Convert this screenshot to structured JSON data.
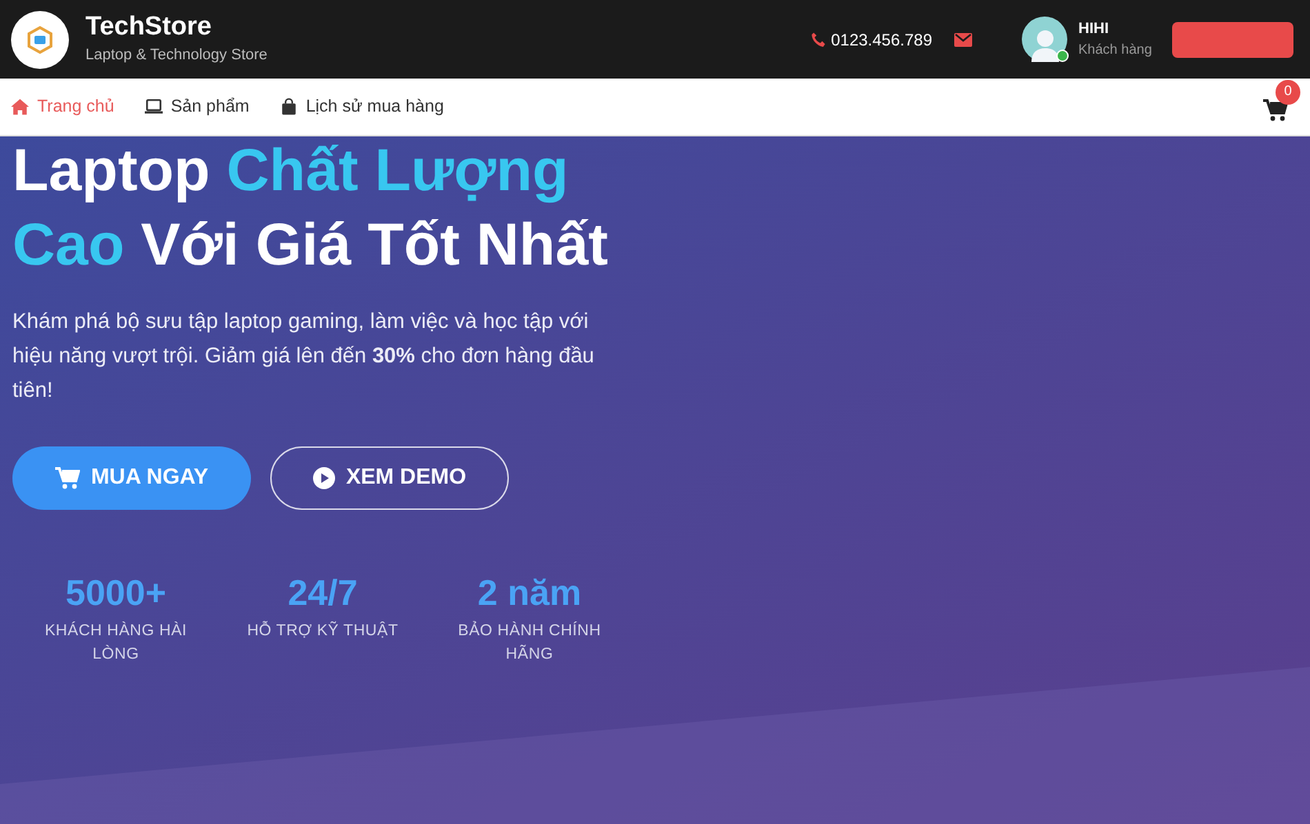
{
  "header": {
    "brand": "TechStore",
    "tagline": "Laptop & Technology Store",
    "phone": "0123.456.789",
    "user": {
      "name": "HIHI",
      "role": "Khách hàng",
      "online": true
    }
  },
  "nav": {
    "items": [
      {
        "label": "Trang chủ",
        "selected": true
      },
      {
        "label": "Sản phẩm",
        "selected": false
      },
      {
        "label": "Lịch sử mua hàng",
        "selected": false
      }
    ],
    "cart_count": "0"
  },
  "hero": {
    "title": [
      {
        "text": "Laptop ",
        "highlight": false
      },
      {
        "text": "Chất Lượng Cao",
        "highlight": true
      },
      {
        "text": " Với Giá Tốt Nhất",
        "highlight": false
      }
    ],
    "description": "Khám phá bộ sưu tập laptop gaming, làm việc và học tập với hiệu năng vượt trội. Giảm giá lên đến **30%** cho đơn hàng đầu tiên!",
    "buttons": [
      {
        "label": "MUA NGAY",
        "kind": "primary"
      },
      {
        "label": "XEM DEMO",
        "kind": "outline"
      }
    ],
    "stats": [
      {
        "value": "5000+",
        "label": "KHÁCH HÀNG HÀI LÒNG"
      },
      {
        "value": "24/7",
        "label": "HỖ TRỢ KỸ THUẬT"
      },
      {
        "value": "2 năm",
        "label": "BẢO HÀNH CHÍNH HÃNG"
      }
    ]
  }
}
